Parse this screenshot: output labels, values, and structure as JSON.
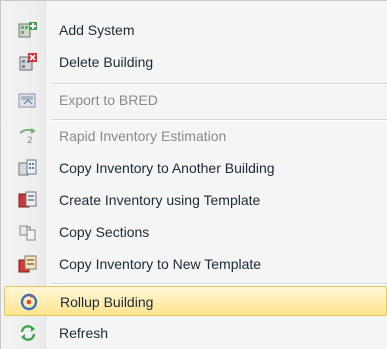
{
  "menu": {
    "items": [
      {
        "label": "Add System",
        "icon": "add-system-icon",
        "disabled": false
      },
      {
        "label": "Delete Building",
        "icon": "delete-building-icon",
        "disabled": false
      },
      {
        "label": "Export to BRED",
        "icon": "export-icon",
        "disabled": true
      },
      {
        "label": "Rapid Inventory Estimation",
        "icon": "rapid-inventory-icon",
        "disabled": true
      },
      {
        "label": "Copy Inventory to Another Building",
        "icon": "copy-inventory-building-icon",
        "disabled": false
      },
      {
        "label": "Create Inventory using Template",
        "icon": "create-inventory-template-icon",
        "disabled": false
      },
      {
        "label": "Copy Sections",
        "icon": "copy-sections-icon",
        "disabled": false
      },
      {
        "label": "Copy Inventory to New Template",
        "icon": "copy-inventory-template-icon",
        "disabled": false
      },
      {
        "label": "Rollup Building",
        "icon": "rollup-icon",
        "disabled": false,
        "highlighted": true
      },
      {
        "label": "Refresh",
        "icon": "refresh-icon",
        "disabled": false
      }
    ]
  },
  "colors": {
    "highlight_top": "#fff7d8",
    "highlight_bottom": "#ffe58e",
    "text": "#1b2a3a",
    "disabled_text": "#8a8a8a"
  }
}
